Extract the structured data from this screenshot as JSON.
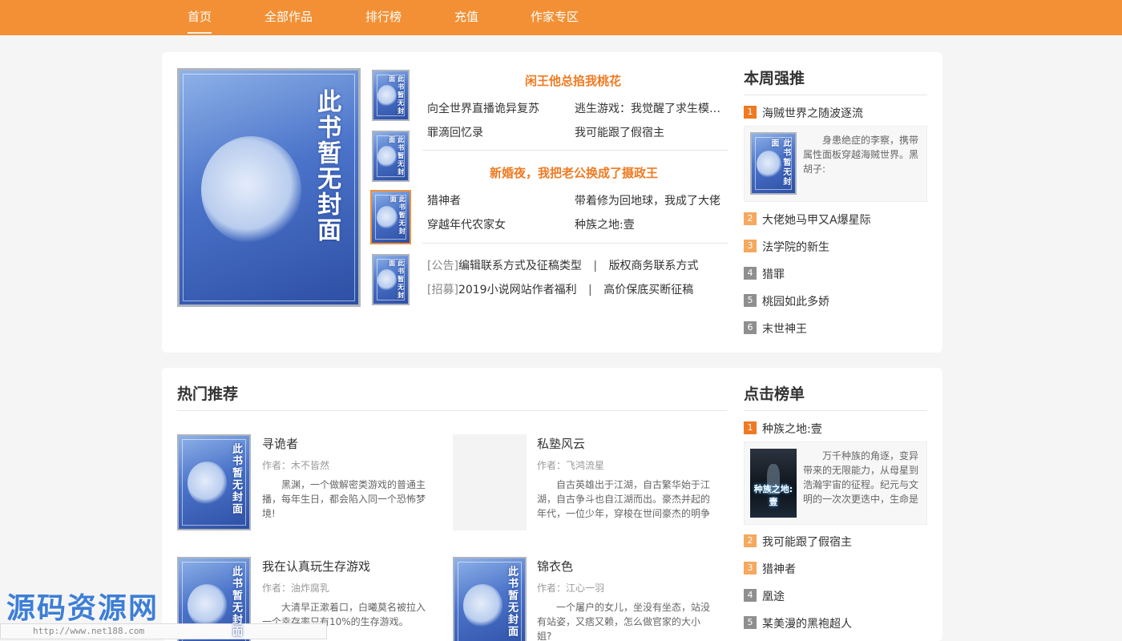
{
  "nav": {
    "items": [
      "首页",
      "全部作品",
      "排行榜",
      "充值",
      "作家专区"
    ]
  },
  "cover_placeholder": "此书暂无封面",
  "featured": {
    "groups": [
      {
        "title": "闲王他总掐我桃花",
        "links": [
          "向全世界直播诡异复苏",
          "逃生游戏：我觉醒了求生模…",
          "罪滴回忆录",
          "我可能跟了假宿主"
        ]
      },
      {
        "title": "新婚夜，我把老公换成了摄政王",
        "links": [
          "猎神者",
          "带着修为回地球，我成了大佬",
          "穿越年代农家女",
          "种族之地:壹"
        ]
      }
    ],
    "notices": [
      {
        "tag": "[公告]",
        "first": "编辑联系方式及征稿类型",
        "sep": "|",
        "second": "版权商务联系方式"
      },
      {
        "tag": "[招募]",
        "first": "2019小说网站作者福利",
        "sep": "|",
        "second": "高价保底买断征稿"
      }
    ]
  },
  "weekly": {
    "title": "本周强推",
    "top_desc": "身患绝症的李察，携带属性面板穿越海贼世界。黑胡子:",
    "items": [
      {
        "rank": "1",
        "name": "海贼世界之随波逐流"
      },
      {
        "rank": "2",
        "name": "大佬她马甲又A爆星际"
      },
      {
        "rank": "3",
        "name": "法学院的新生"
      },
      {
        "rank": "4",
        "name": "猎罪"
      },
      {
        "rank": "5",
        "name": "桃园如此多娇"
      },
      {
        "rank": "6",
        "name": "末世神王"
      }
    ]
  },
  "hot": {
    "title": "热门推荐",
    "books": [
      {
        "name": "寻诡者",
        "author": "作者：木不皆然",
        "desc": "黑渊，一个做解密类游戏的普通主播，每年生日，都会陷入同一个恐怖梦境!"
      },
      {
        "name": "私塾风云",
        "author": "作者：飞鸿流星",
        "desc": "自古英雄出于江湖，自古繁华始于江湖，自古争斗也自江湖而出。豪杰并起的年代，一位少年，穿梭在世间豪杰的明争暗斗"
      },
      {
        "name": "我在认真玩生存游戏",
        "author": "作者：油炸腐乳",
        "desc": "大清早正漱着口，白曦莫名被拉入一个幸存率只有10%的生存游戏。"
      },
      {
        "name": "锦衣色",
        "author": "作者：江心一羽",
        "desc": "一个屠户的女儿，坐没有坐态，站没有站姿，又痞又赖，怎么做官家的大小姐?"
      }
    ]
  },
  "clicks": {
    "title": "点击榜单",
    "top_desc": "万千种族的角逐，变异带来的无限能力，从母星到浩瀚宇宙的征程。纪元与文明的一次次更迭中，生命是否",
    "top_cover_title": "种族之地:壹",
    "items": [
      {
        "rank": "1",
        "name": "种族之地:壹"
      },
      {
        "rank": "2",
        "name": "我可能跟了假宿主"
      },
      {
        "rank": "3",
        "name": "猎神者"
      },
      {
        "rank": "4",
        "name": "凰途"
      },
      {
        "rank": "5",
        "name": "某美漫的黑袍超人"
      }
    ]
  },
  "watermark": {
    "brand": "源码资源网",
    "url": "http://www.net188.com"
  }
}
